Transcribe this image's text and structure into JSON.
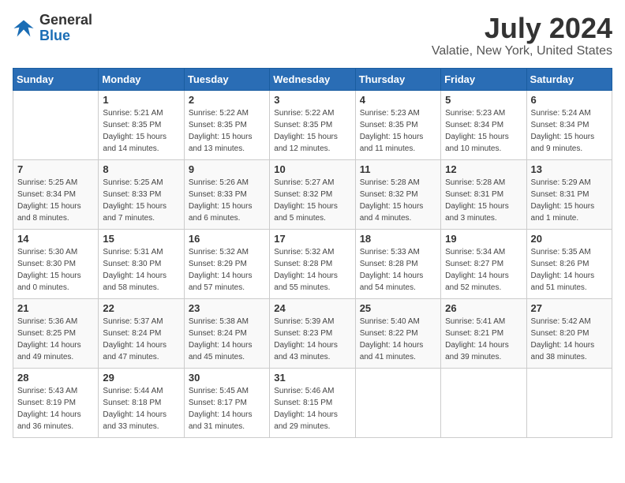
{
  "header": {
    "logo_general": "General",
    "logo_blue": "Blue",
    "month_title": "July 2024",
    "location": "Valatie, New York, United States"
  },
  "weekdays": [
    "Sunday",
    "Monday",
    "Tuesday",
    "Wednesday",
    "Thursday",
    "Friday",
    "Saturday"
  ],
  "weeks": [
    [
      {
        "day": "",
        "sunrise": "",
        "sunset": "",
        "daylight": ""
      },
      {
        "day": "1",
        "sunrise": "Sunrise: 5:21 AM",
        "sunset": "Sunset: 8:35 PM",
        "daylight": "Daylight: 15 hours and 14 minutes."
      },
      {
        "day": "2",
        "sunrise": "Sunrise: 5:22 AM",
        "sunset": "Sunset: 8:35 PM",
        "daylight": "Daylight: 15 hours and 13 minutes."
      },
      {
        "day": "3",
        "sunrise": "Sunrise: 5:22 AM",
        "sunset": "Sunset: 8:35 PM",
        "daylight": "Daylight: 15 hours and 12 minutes."
      },
      {
        "day": "4",
        "sunrise": "Sunrise: 5:23 AM",
        "sunset": "Sunset: 8:35 PM",
        "daylight": "Daylight: 15 hours and 11 minutes."
      },
      {
        "day": "5",
        "sunrise": "Sunrise: 5:23 AM",
        "sunset": "Sunset: 8:34 PM",
        "daylight": "Daylight: 15 hours and 10 minutes."
      },
      {
        "day": "6",
        "sunrise": "Sunrise: 5:24 AM",
        "sunset": "Sunset: 8:34 PM",
        "daylight": "Daylight: 15 hours and 9 minutes."
      }
    ],
    [
      {
        "day": "7",
        "sunrise": "Sunrise: 5:25 AM",
        "sunset": "Sunset: 8:34 PM",
        "daylight": "Daylight: 15 hours and 8 minutes."
      },
      {
        "day": "8",
        "sunrise": "Sunrise: 5:25 AM",
        "sunset": "Sunset: 8:33 PM",
        "daylight": "Daylight: 15 hours and 7 minutes."
      },
      {
        "day": "9",
        "sunrise": "Sunrise: 5:26 AM",
        "sunset": "Sunset: 8:33 PM",
        "daylight": "Daylight: 15 hours and 6 minutes."
      },
      {
        "day": "10",
        "sunrise": "Sunrise: 5:27 AM",
        "sunset": "Sunset: 8:32 PM",
        "daylight": "Daylight: 15 hours and 5 minutes."
      },
      {
        "day": "11",
        "sunrise": "Sunrise: 5:28 AM",
        "sunset": "Sunset: 8:32 PM",
        "daylight": "Daylight: 15 hours and 4 minutes."
      },
      {
        "day": "12",
        "sunrise": "Sunrise: 5:28 AM",
        "sunset": "Sunset: 8:31 PM",
        "daylight": "Daylight: 15 hours and 3 minutes."
      },
      {
        "day": "13",
        "sunrise": "Sunrise: 5:29 AM",
        "sunset": "Sunset: 8:31 PM",
        "daylight": "Daylight: 15 hours and 1 minute."
      }
    ],
    [
      {
        "day": "14",
        "sunrise": "Sunrise: 5:30 AM",
        "sunset": "Sunset: 8:30 PM",
        "daylight": "Daylight: 15 hours and 0 minutes."
      },
      {
        "day": "15",
        "sunrise": "Sunrise: 5:31 AM",
        "sunset": "Sunset: 8:30 PM",
        "daylight": "Daylight: 14 hours and 58 minutes."
      },
      {
        "day": "16",
        "sunrise": "Sunrise: 5:32 AM",
        "sunset": "Sunset: 8:29 PM",
        "daylight": "Daylight: 14 hours and 57 minutes."
      },
      {
        "day": "17",
        "sunrise": "Sunrise: 5:32 AM",
        "sunset": "Sunset: 8:28 PM",
        "daylight": "Daylight: 14 hours and 55 minutes."
      },
      {
        "day": "18",
        "sunrise": "Sunrise: 5:33 AM",
        "sunset": "Sunset: 8:28 PM",
        "daylight": "Daylight: 14 hours and 54 minutes."
      },
      {
        "day": "19",
        "sunrise": "Sunrise: 5:34 AM",
        "sunset": "Sunset: 8:27 PM",
        "daylight": "Daylight: 14 hours and 52 minutes."
      },
      {
        "day": "20",
        "sunrise": "Sunrise: 5:35 AM",
        "sunset": "Sunset: 8:26 PM",
        "daylight": "Daylight: 14 hours and 51 minutes."
      }
    ],
    [
      {
        "day": "21",
        "sunrise": "Sunrise: 5:36 AM",
        "sunset": "Sunset: 8:25 PM",
        "daylight": "Daylight: 14 hours and 49 minutes."
      },
      {
        "day": "22",
        "sunrise": "Sunrise: 5:37 AM",
        "sunset": "Sunset: 8:24 PM",
        "daylight": "Daylight: 14 hours and 47 minutes."
      },
      {
        "day": "23",
        "sunrise": "Sunrise: 5:38 AM",
        "sunset": "Sunset: 8:24 PM",
        "daylight": "Daylight: 14 hours and 45 minutes."
      },
      {
        "day": "24",
        "sunrise": "Sunrise: 5:39 AM",
        "sunset": "Sunset: 8:23 PM",
        "daylight": "Daylight: 14 hours and 43 minutes."
      },
      {
        "day": "25",
        "sunrise": "Sunrise: 5:40 AM",
        "sunset": "Sunset: 8:22 PM",
        "daylight": "Daylight: 14 hours and 41 minutes."
      },
      {
        "day": "26",
        "sunrise": "Sunrise: 5:41 AM",
        "sunset": "Sunset: 8:21 PM",
        "daylight": "Daylight: 14 hours and 39 minutes."
      },
      {
        "day": "27",
        "sunrise": "Sunrise: 5:42 AM",
        "sunset": "Sunset: 8:20 PM",
        "daylight": "Daylight: 14 hours and 38 minutes."
      }
    ],
    [
      {
        "day": "28",
        "sunrise": "Sunrise: 5:43 AM",
        "sunset": "Sunset: 8:19 PM",
        "daylight": "Daylight: 14 hours and 36 minutes."
      },
      {
        "day": "29",
        "sunrise": "Sunrise: 5:44 AM",
        "sunset": "Sunset: 8:18 PM",
        "daylight": "Daylight: 14 hours and 33 minutes."
      },
      {
        "day": "30",
        "sunrise": "Sunrise: 5:45 AM",
        "sunset": "Sunset: 8:17 PM",
        "daylight": "Daylight: 14 hours and 31 minutes."
      },
      {
        "day": "31",
        "sunrise": "Sunrise: 5:46 AM",
        "sunset": "Sunset: 8:15 PM",
        "daylight": "Daylight: 14 hours and 29 minutes."
      },
      {
        "day": "",
        "sunrise": "",
        "sunset": "",
        "daylight": ""
      },
      {
        "day": "",
        "sunrise": "",
        "sunset": "",
        "daylight": ""
      },
      {
        "day": "",
        "sunrise": "",
        "sunset": "",
        "daylight": ""
      }
    ]
  ]
}
